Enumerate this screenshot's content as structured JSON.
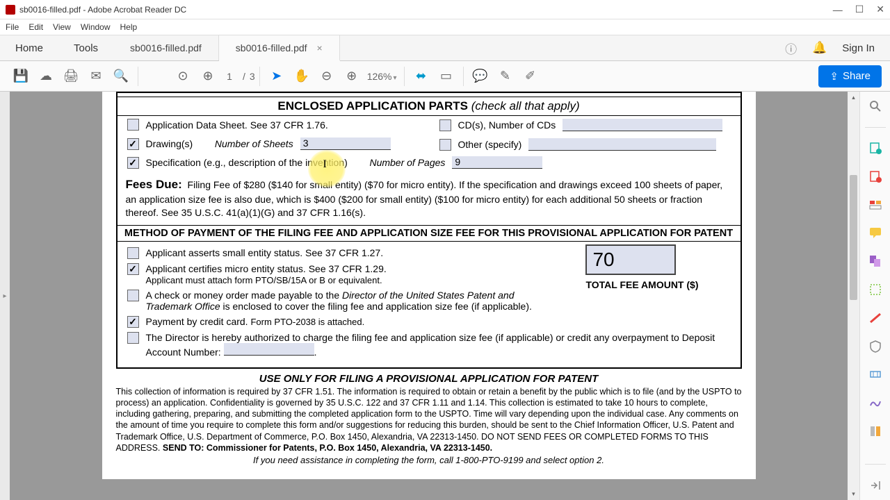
{
  "titlebar": {
    "filename": "sb0016-filled.pdf",
    "app": "Adobe Acrobat Reader DC"
  },
  "menubar": [
    "File",
    "Edit",
    "View",
    "Window",
    "Help"
  ],
  "tabrow": {
    "home": "Home",
    "tools": "Tools",
    "tabs": [
      {
        "label": "sb0016-filled.pdf",
        "active": false,
        "closable": false
      },
      {
        "label": "sb0016-filled.pdf",
        "active": true,
        "closable": true
      }
    ],
    "signin": "Sign In"
  },
  "toolbar": {
    "current_page": "1",
    "total_pages": "3",
    "zoom": "126%",
    "share": "Share"
  },
  "form": {
    "enclosed_header": "ENCLOSED APPLICATION PARTS",
    "enclosed_sub": "(check all that apply)",
    "app_data_sheet": "Application Data Sheet. See 37 CFR 1.76.",
    "cds_label": "CD(s), Number of CDs",
    "drawings_label": "Drawing(s)",
    "num_sheets_label": "Number of Sheets",
    "num_sheets_value": "3",
    "other_label": "Other (specify)",
    "spec_label": "Specification (e.g., description of the invention)",
    "num_pages_label": "Number of Pages",
    "num_pages_value": "9",
    "fees_due_label": "Fees Due:",
    "fees_due_text": "Filing Fee of $280 ($140 for small entity) ($70 for micro entity). If the specification and drawings exceed 100 sheets of paper, an application size fee is also due, which is $400 ($200 for small entity) ($100 for micro entity) for each additional 50 sheets or fraction thereof. See 35 U.S.C. 41(a)(1)(G) and 37 CFR 1.16(s).",
    "method_header": "METHOD OF PAYMENT OF THE FILING FEE AND APPLICATION SIZE FEE FOR THIS PROVISIONAL APPLICATION FOR PATENT",
    "small_entity": "Applicant asserts small entity status. See 37 CFR 1.27.",
    "micro_entity": "Applicant certifies micro entity status. See 37 CFR 1.29.",
    "micro_attach": "Applicant must attach form PTO/SB/15A or B or equivalent.",
    "check_payable": "A check or money order made payable to the ",
    "check_payable_italic": "Director of the United States Patent and Trademark Office",
    "check_payable_rest": " is enclosed to cover the filing fee and application size fee (if applicable).",
    "credit_card": "Payment by credit card.",
    "credit_card_note": "Form PTO-2038 is attached.",
    "director_auth": "The Director is hereby authorized to charge the filing fee and application size fee (if applicable) or credit any overpayment to Deposit Account Number:",
    "total_fee_value": "70",
    "total_fee_label": "TOTAL FEE AMOUNT ($)",
    "use_only_header": "USE ONLY FOR FILING A PROVISIONAL APPLICATION FOR PATENT",
    "fine_print": "This collection of information is required by 37 CFR 1.51. The information is required to obtain or retain a benefit by the public which is to file (and by the USPTO to process) an application. Confidentiality is governed by 35 U.S.C. 122 and 37 CFR 1.11 and 1.14. This collection is estimated to take 10 hours to complete, including gathering, preparing, and submitting the completed application form to the USPTO. Time will vary depending upon the individual case. Any comments on the amount of time you require to complete this form and/or suggestions for reducing this burden, should be sent to the Chief Information Officer, U.S. Patent and Trademark Office, U.S. Department of Commerce, P.O. Box 1450, Alexandria, VA 22313-1450. DO NOT SEND FEES OR COMPLETED FORMS TO THIS ADDRESS. ",
    "send_to_bold": "SEND TO: Commissioner for Patents, P.O. Box 1450, Alexandria, VA 22313-1450.",
    "assistance": "If you need assistance in completing the form, call 1-800-PTO-9199 and select option 2."
  }
}
